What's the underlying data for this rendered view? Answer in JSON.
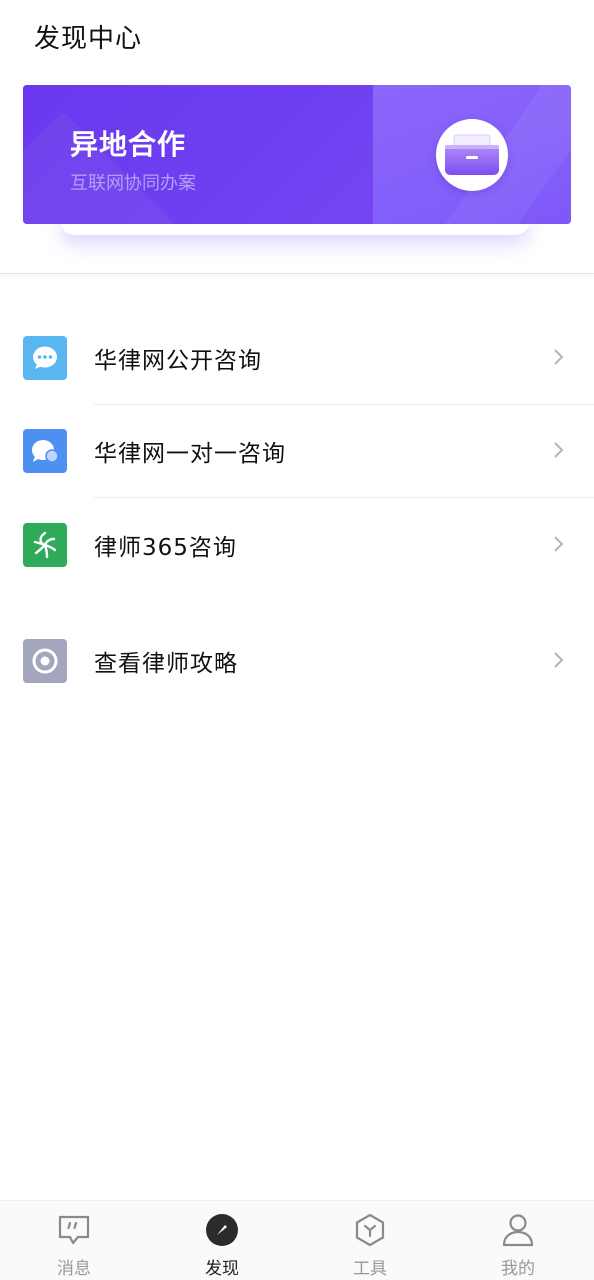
{
  "header": {
    "title": "发现中心"
  },
  "banner": {
    "title": "异地合作",
    "subtitle": "互联网协同办案",
    "colors": {
      "left": "#6b3cef",
      "right": "#8a66fb"
    }
  },
  "menu": {
    "items": [
      {
        "label": "华律网公开咨询",
        "icon": "chat-dots-icon",
        "color": "#5ab6f0"
      },
      {
        "label": "华律网一对一咨询",
        "icon": "chat-bubble-icon",
        "color": "#4d8ff2"
      },
      {
        "label": "律师365咨询",
        "icon": "lawyer365-logo-icon",
        "color": "#2eaa5a"
      },
      {
        "label": "查看律师攻略",
        "icon": "target-icon",
        "color": "#a3a6bd"
      }
    ]
  },
  "nav": {
    "items": [
      {
        "label": "消息",
        "icon": "message-icon",
        "active": false
      },
      {
        "label": "发现",
        "icon": "compass-icon",
        "active": true
      },
      {
        "label": "工具",
        "icon": "cube-icon",
        "active": false
      },
      {
        "label": "我的",
        "icon": "person-icon",
        "active": false
      }
    ]
  }
}
